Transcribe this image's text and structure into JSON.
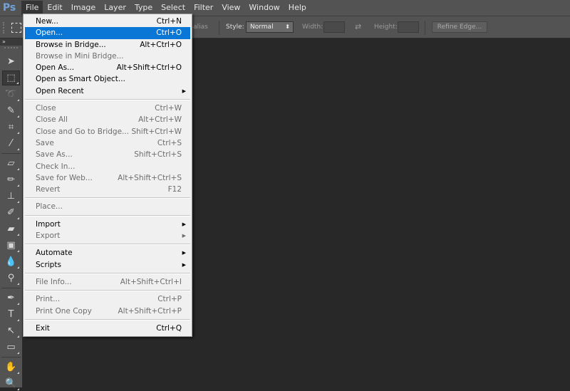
{
  "app": {
    "logo": "Ps",
    "accent_color": "#0a77d6"
  },
  "menubar": [
    {
      "label": "File",
      "active": true
    },
    {
      "label": "Edit"
    },
    {
      "label": "Image"
    },
    {
      "label": "Layer"
    },
    {
      "label": "Type"
    },
    {
      "label": "Select"
    },
    {
      "label": "Filter"
    },
    {
      "label": "View"
    },
    {
      "label": "Window"
    },
    {
      "label": "Help"
    }
  ],
  "options": {
    "antialias_label": "Anti-alias",
    "style_label": "Style:",
    "style_value": "Normal",
    "width_label": "Width:",
    "width_value": "",
    "height_label": "Height:",
    "height_value": "",
    "refine_edge_label": "Refine Edge..."
  },
  "toolbar": {
    "collapse_icon": "»",
    "tools": [
      {
        "name": "move-tool-icon",
        "glyph": "➤"
      },
      {
        "name": "rectangular-marquee-tool-icon",
        "glyph": "⬚",
        "active": true
      },
      {
        "name": "lasso-tool-icon",
        "glyph": "➰"
      },
      {
        "name": "quick-selection-tool-icon",
        "glyph": "✎"
      },
      {
        "name": "crop-tool-icon",
        "glyph": "⌗"
      },
      {
        "name": "eyedropper-tool-icon",
        "glyph": "⁄"
      },
      {
        "sep": true
      },
      {
        "name": "healing-brush-tool-icon",
        "glyph": "▱"
      },
      {
        "name": "brush-tool-icon",
        "glyph": "✏"
      },
      {
        "name": "clone-stamp-tool-icon",
        "glyph": "⊥"
      },
      {
        "name": "history-brush-tool-icon",
        "glyph": "✐"
      },
      {
        "name": "eraser-tool-icon",
        "glyph": "▰"
      },
      {
        "name": "gradient-tool-icon",
        "glyph": "▣"
      },
      {
        "name": "blur-tool-icon",
        "glyph": "💧"
      },
      {
        "name": "dodge-tool-icon",
        "glyph": "⚲"
      },
      {
        "sep": true
      },
      {
        "name": "pen-tool-icon",
        "glyph": "✒"
      },
      {
        "name": "type-tool-icon",
        "glyph": "T"
      },
      {
        "name": "path-selection-tool-icon",
        "glyph": "↖"
      },
      {
        "name": "rectangle-tool-icon",
        "glyph": "▭"
      },
      {
        "sep": true
      },
      {
        "name": "hand-tool-icon",
        "glyph": "✋"
      },
      {
        "name": "zoom-tool-icon",
        "glyph": "🔍"
      }
    ]
  },
  "file_menu": [
    {
      "label": "New...",
      "shortcut": "Ctrl+N"
    },
    {
      "label": "Open...",
      "shortcut": "Ctrl+O",
      "highlighted": true
    },
    {
      "label": "Browse in Bridge...",
      "shortcut": "Alt+Ctrl+O"
    },
    {
      "label": "Browse in Mini Bridge...",
      "shortcut": "",
      "disabled": true
    },
    {
      "label": "Open As...",
      "shortcut": "Alt+Shift+Ctrl+O"
    },
    {
      "label": "Open as Smart Object...",
      "shortcut": ""
    },
    {
      "label": "Open Recent",
      "shortcut": "",
      "submenu": true
    },
    {
      "sep": true
    },
    {
      "label": "Close",
      "shortcut": "Ctrl+W",
      "disabled": true
    },
    {
      "label": "Close All",
      "shortcut": "Alt+Ctrl+W",
      "disabled": true
    },
    {
      "label": "Close and Go to Bridge...",
      "shortcut": "Shift+Ctrl+W",
      "disabled": true
    },
    {
      "label": "Save",
      "shortcut": "Ctrl+S",
      "disabled": true
    },
    {
      "label": "Save As...",
      "shortcut": "Shift+Ctrl+S",
      "disabled": true
    },
    {
      "label": "Check In...",
      "shortcut": "",
      "disabled": true
    },
    {
      "label": "Save for Web...",
      "shortcut": "Alt+Shift+Ctrl+S",
      "disabled": true
    },
    {
      "label": "Revert",
      "shortcut": "F12",
      "disabled": true
    },
    {
      "sep": true
    },
    {
      "label": "Place...",
      "shortcut": "",
      "disabled": true
    },
    {
      "sep": true
    },
    {
      "label": "Import",
      "shortcut": "",
      "submenu": true
    },
    {
      "label": "Export",
      "shortcut": "",
      "submenu": true,
      "disabled": true
    },
    {
      "sep": true
    },
    {
      "label": "Automate",
      "shortcut": "",
      "submenu": true
    },
    {
      "label": "Scripts",
      "shortcut": "",
      "submenu": true
    },
    {
      "sep": true
    },
    {
      "label": "File Info...",
      "shortcut": "Alt+Shift+Ctrl+I",
      "disabled": true
    },
    {
      "sep": true
    },
    {
      "label": "Print...",
      "shortcut": "Ctrl+P",
      "disabled": true
    },
    {
      "label": "Print One Copy",
      "shortcut": "Alt+Shift+Ctrl+P",
      "disabled": true
    },
    {
      "sep": true
    },
    {
      "label": "Exit",
      "shortcut": "Ctrl+Q"
    }
  ]
}
